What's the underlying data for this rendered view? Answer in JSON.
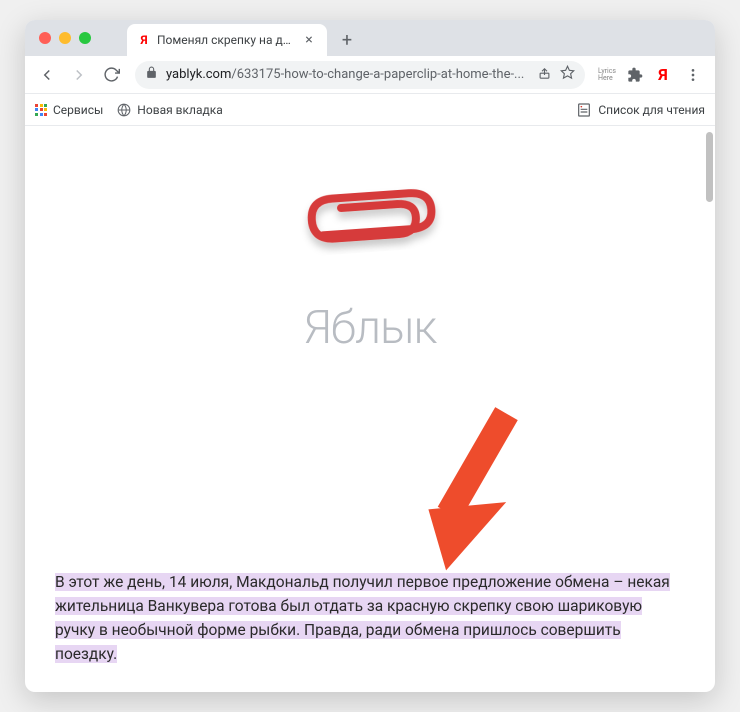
{
  "window": {
    "tab_title": "Поменял скрепку на дом: ре",
    "url_domain": "yablyk.com",
    "url_path": "/633175-how-to-change-a-paperclip-at-home-the-...",
    "new_tab_label": "+"
  },
  "bookmarks": {
    "apps": "Сервисы",
    "new_tab": "Новая вкладка",
    "reading_list": "Список для чтения"
  },
  "extensions": {
    "lyrics": "Lyrics\nHere"
  },
  "page": {
    "brand": "Яблык",
    "paragraph": "В этот же день, 14 июля, Макдональд получил первое предложение обмена – некая жительница Ванкувера готова был отдать за красную скрепку свою шариковую ручку в необычной форме рыбки. Правда, ради обмена пришлось совершить поездку."
  },
  "colors": {
    "highlight": "#e7d6f3",
    "clip_red": "#d63b3b",
    "arrow_red": "#ee4c2c"
  }
}
